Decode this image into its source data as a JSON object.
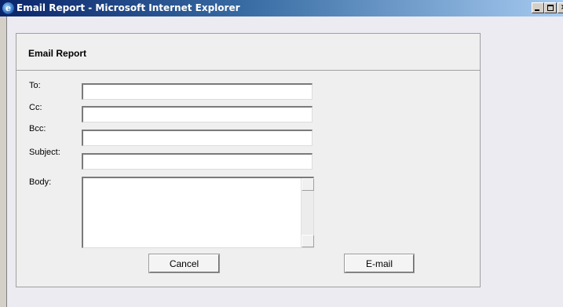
{
  "window": {
    "title": "Email Report - Microsoft Internet Explorer",
    "app_icon": "ie-icon",
    "controls": {
      "minimize": "minimize-icon",
      "maximize": "maximize-icon",
      "close_glyph": "×"
    }
  },
  "form": {
    "title": "Email Report",
    "fields": [
      {
        "label": "To:",
        "value": "",
        "placeholder": ""
      },
      {
        "label": "Cc:",
        "value": "",
        "placeholder": ""
      },
      {
        "label": "Bcc:",
        "value": "",
        "placeholder": ""
      },
      {
        "label": "Subject:",
        "value": "",
        "placeholder": ""
      }
    ],
    "body": {
      "label": "Body:",
      "value": ""
    },
    "buttons": {
      "cancel": "Cancel",
      "email": "E-mail"
    }
  }
}
